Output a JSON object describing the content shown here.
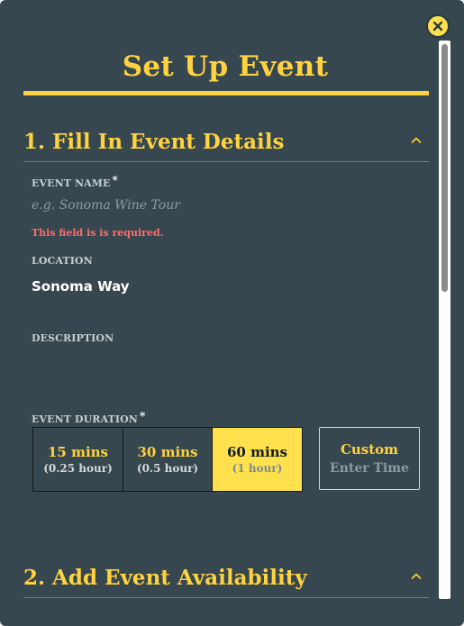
{
  "modal": {
    "title": "Set Up Event",
    "close_icon": "close-icon"
  },
  "section1": {
    "heading": "1. Fill In Event Details",
    "event_name": {
      "label": "EVENT NAME",
      "required_mark": "*",
      "placeholder": "e.g. Sonoma Wine Tour",
      "value": "",
      "error": "This field is is required."
    },
    "location": {
      "label": "LOCATION",
      "value": "Sonoma Way"
    },
    "description": {
      "label": "DESCRIPTION",
      "value": ""
    },
    "duration": {
      "label": "EVENT DURATION",
      "required_mark": "*",
      "options": [
        {
          "main": "15 mins",
          "sub": "(0.25 hour)"
        },
        {
          "main": "30 mins",
          "sub": "(0.5 hour)"
        },
        {
          "main": "60 mins",
          "sub": "(1 hour)"
        }
      ],
      "selected_index": 2,
      "custom": {
        "label": "Custom",
        "placeholder": "Enter Time"
      }
    }
  },
  "section2": {
    "heading": "2. Add Event Availability"
  },
  "colors": {
    "background": "#37474f",
    "accent": "#ffd23f",
    "selected": "#ffe14d",
    "error": "#ff6b6b"
  }
}
